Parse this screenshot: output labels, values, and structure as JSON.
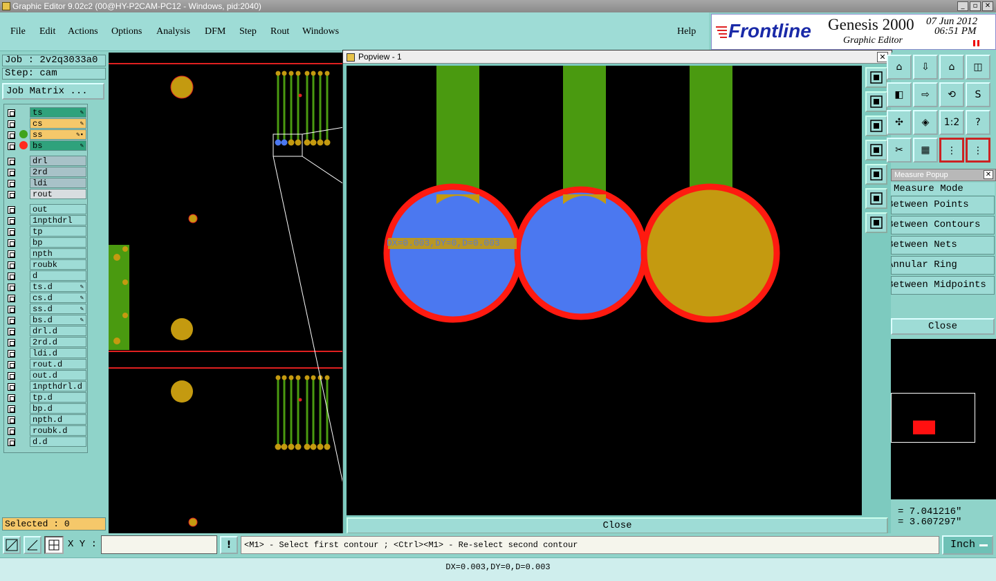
{
  "window": {
    "title": "Graphic Editor 9.02c2 (00@HY-P2CAM-PC12 - Windows, pid:2040)"
  },
  "menu": {
    "items": [
      {
        "label": "File"
      },
      {
        "label": "Edit"
      },
      {
        "label": "Actions"
      },
      {
        "label": "Options"
      },
      {
        "label": "Analysis"
      },
      {
        "label": "DFM"
      },
      {
        "label": "Step"
      },
      {
        "label": "Rout"
      },
      {
        "label": "Windows"
      }
    ],
    "help": "Help"
  },
  "brand": {
    "logo": "Frontline",
    "product": "Genesis 2000",
    "subtitle": "Graphic Editor",
    "date": "07 Jun 2012",
    "time": "06:51 PM"
  },
  "job": {
    "job_label": "Job : 2v2q3033a0",
    "step_label": "Step: cam",
    "matrix_button": "Job Matrix ..."
  },
  "layers": [
    {
      "name": "ts",
      "color": "#2fa27c",
      "dot": "",
      "flag": "✎"
    },
    {
      "name": "cs",
      "color": "#f5c86a",
      "dot": "",
      "flag": "✎"
    },
    {
      "name": "ss",
      "color": "#f5c86a",
      "dot": "#3fa31c",
      "flag": "✎▪"
    },
    {
      "name": "bs",
      "color": "#2fa27c",
      "dot": "#ff2a1f",
      "flag": "✎"
    },
    {
      "name": "drl",
      "color": "#a8c2c8",
      "dot": "",
      "flag": ""
    },
    {
      "name": "2rd",
      "color": "#a8c2c8",
      "dot": "",
      "flag": ""
    },
    {
      "name": "ldi",
      "color": "#a8c2c8",
      "dot": "",
      "flag": ""
    },
    {
      "name": "rout",
      "color": "#d8dde0",
      "dot": "",
      "flag": ""
    },
    {
      "name": "out",
      "color": "#9edcd6",
      "dot": "",
      "flag": ""
    },
    {
      "name": "1npthdrl",
      "color": "#9edcd6",
      "dot": "",
      "flag": ""
    },
    {
      "name": "tp",
      "color": "#9edcd6",
      "dot": "",
      "flag": ""
    },
    {
      "name": "bp",
      "color": "#9edcd6",
      "dot": "",
      "flag": ""
    },
    {
      "name": "npth",
      "color": "#9edcd6",
      "dot": "",
      "flag": ""
    },
    {
      "name": "roubk",
      "color": "#9edcd6",
      "dot": "",
      "flag": ""
    },
    {
      "name": "d",
      "color": "#9edcd6",
      "dot": "",
      "flag": ""
    },
    {
      "name": "ts.d",
      "color": "#9edcd6",
      "dot": "",
      "flag": "✎"
    },
    {
      "name": "cs.d",
      "color": "#9edcd6",
      "dot": "",
      "flag": "✎"
    },
    {
      "name": "ss.d",
      "color": "#9edcd6",
      "dot": "",
      "flag": "✎"
    },
    {
      "name": "bs.d",
      "color": "#9edcd6",
      "dot": "",
      "flag": "✎"
    },
    {
      "name": "drl.d",
      "color": "#9edcd6",
      "dot": "",
      "flag": ""
    },
    {
      "name": "2rd.d",
      "color": "#9edcd6",
      "dot": "",
      "flag": ""
    },
    {
      "name": "ldi.d",
      "color": "#9edcd6",
      "dot": "",
      "flag": ""
    },
    {
      "name": "rout.d",
      "color": "#9edcd6",
      "dot": "",
      "flag": ""
    },
    {
      "name": "out.d",
      "color": "#9edcd6",
      "dot": "",
      "flag": ""
    },
    {
      "name": "1npthdrl.d",
      "color": "#9edcd6",
      "dot": "",
      "flag": ""
    },
    {
      "name": "tp.d",
      "color": "#9edcd6",
      "dot": "",
      "flag": ""
    },
    {
      "name": "bp.d",
      "color": "#9edcd6",
      "dot": "",
      "flag": ""
    },
    {
      "name": "npth.d",
      "color": "#9edcd6",
      "dot": "",
      "flag": ""
    },
    {
      "name": "roubk.d",
      "color": "#9edcd6",
      "dot": "",
      "flag": ""
    },
    {
      "name": "d.d",
      "color": "#9edcd6",
      "dot": "",
      "flag": ""
    }
  ],
  "selected": "Selected : 0",
  "popview": {
    "title": "Popview - 1",
    "measure_label": "DX=0.003,DY=0,D=0.003",
    "close": "Close"
  },
  "measure_popup": {
    "title": "Measure Popup",
    "mode_header": "Measure Mode",
    "modes": [
      "Between Points",
      "Between Contours",
      "Between Nets",
      "Annular Ring",
      "Between Midpoints"
    ],
    "close": "Close"
  },
  "toolbar_right": {
    "scale_label": "1:2",
    "help_glyph": "?"
  },
  "coords": {
    "x": "= 7.041216\"",
    "y": "= 3.607297\""
  },
  "status": {
    "xy_label": "X Y :",
    "xy_value": "",
    "hint": "<M1> - Select first contour ; <Ctrl><M1> - Re-select second contour",
    "units": "Inch",
    "bottom_message": "DX=0.003,DY=0,D=0.003"
  }
}
